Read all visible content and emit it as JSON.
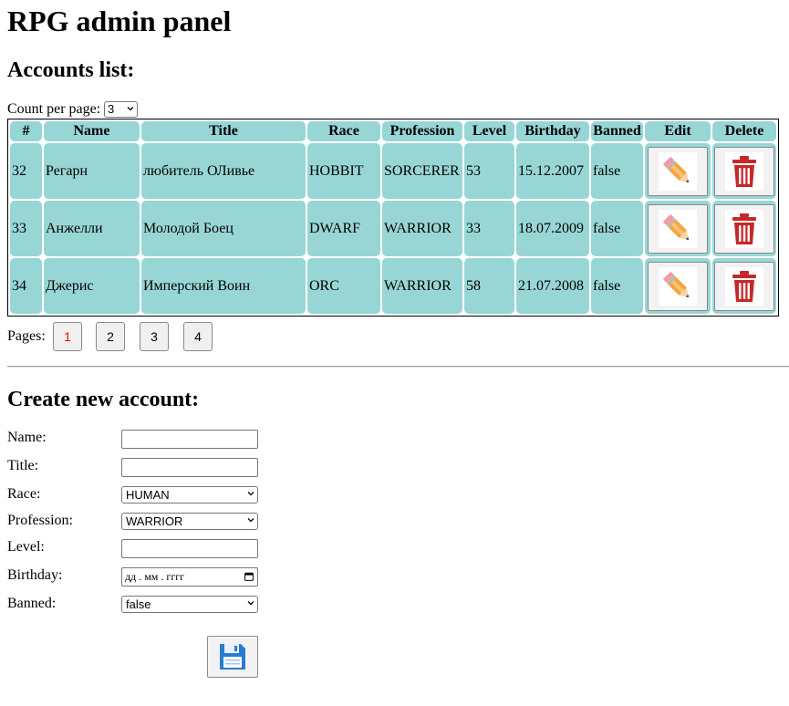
{
  "page": {
    "title": "RPG admin panel",
    "accounts_heading": "Accounts list:",
    "create_heading": "Create new account:"
  },
  "count_per_page": {
    "label": "Count per page:",
    "value": "3"
  },
  "table": {
    "headers": [
      "#",
      "Name",
      "Title",
      "Race",
      "Profession",
      "Level",
      "Birthday",
      "Banned",
      "Edit",
      "Delete"
    ],
    "rows": [
      {
        "id": "32",
        "name": "Регарн",
        "title": "любитель ОЛивье",
        "race": "HOBBIT",
        "profession": "SORCERER",
        "level": "53",
        "birthday": "15.12.2007",
        "banned": "false"
      },
      {
        "id": "33",
        "name": "Анжелли",
        "title": "Молодой Боец",
        "race": "DWARF",
        "profession": "WARRIOR",
        "level": "33",
        "birthday": "18.07.2009",
        "banned": "false"
      },
      {
        "id": "34",
        "name": "Джерис",
        "title": "Имперский Воин",
        "race": "ORC",
        "profession": "WARRIOR",
        "level": "58",
        "birthday": "21.07.2008",
        "banned": "false"
      }
    ],
    "edit_icon": "pencil-icon",
    "delete_icon": "trash-icon"
  },
  "pagination": {
    "label": "Pages:",
    "pages": [
      "1",
      "2",
      "3",
      "4"
    ],
    "current": "1"
  },
  "form": {
    "name_label": "Name:",
    "name_value": "",
    "title_label": "Title:",
    "title_value": "",
    "race_label": "Race:",
    "race_value": "HUMAN",
    "profession_label": "Profession:",
    "profession_value": "WARRIOR",
    "level_label": "Level:",
    "level_value": "",
    "birthday_label": "Birthday:",
    "birthday_placeholder": "дд . мм . гггг",
    "banned_label": "Banned:",
    "banned_value": "false",
    "save_icon": "floppy-disk-icon"
  },
  "colors": {
    "table_cell": "#98d6d6",
    "active_page": "#ff0000",
    "delete_icon": "#c62828",
    "save_icon": "#2b7bd0",
    "edit_icon": "#f5a53c"
  }
}
